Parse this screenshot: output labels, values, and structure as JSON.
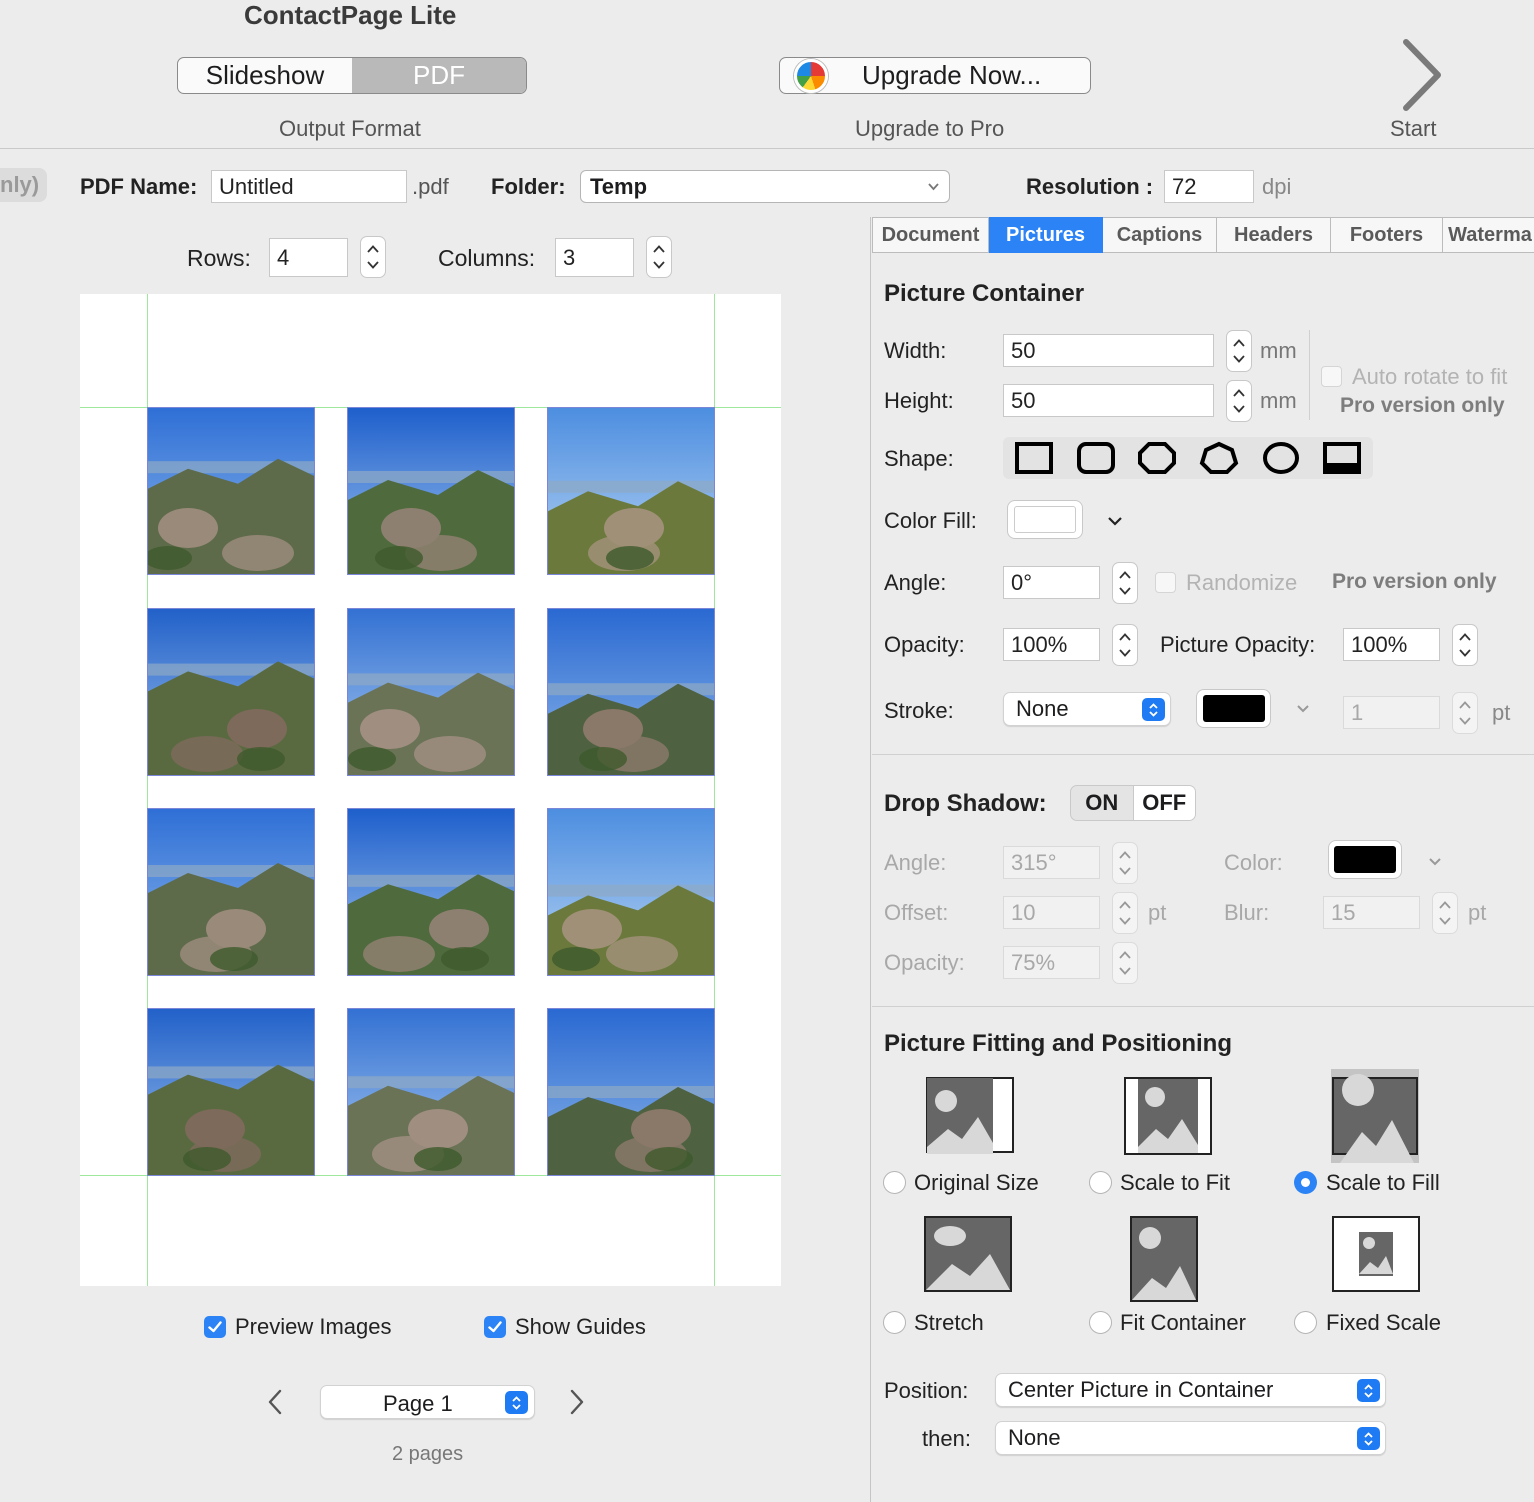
{
  "app": {
    "title": "ContactPage Lite"
  },
  "toolbar": {
    "output_format": {
      "options": [
        "Slideshow",
        "PDF"
      ],
      "selected": "PDF",
      "caption": "Output Format"
    },
    "upgrade": {
      "label": "Upgrade Now...",
      "caption": "Upgrade to Pro"
    },
    "start": {
      "caption": "Start"
    }
  },
  "settings_bar": {
    "left_badge": "nly)",
    "pdf_name_label": "PDF Name:",
    "pdf_name_value": "Untitled",
    "pdf_ext": ".pdf",
    "folder_label": "Folder:",
    "folder_value": "Temp",
    "resolution_label": "Resolution :",
    "resolution_value": "72",
    "resolution_unit": "dpi"
  },
  "grid": {
    "rows_label": "Rows:",
    "rows_value": "4",
    "columns_label": "Columns:",
    "columns_value": "3"
  },
  "preview": {
    "photo_count": 12,
    "preview_images_label": "Preview Images",
    "preview_images_checked": true,
    "show_guides_label": "Show Guides",
    "show_guides_checked": true,
    "page_value": "Page 1",
    "page_count": "2 pages"
  },
  "tabs": [
    {
      "label": "Document"
    },
    {
      "label": "Pictures",
      "active": true
    },
    {
      "label": "Captions"
    },
    {
      "label": "Headers"
    },
    {
      "label": "Footers"
    },
    {
      "label": "Waterma"
    }
  ],
  "picture_container": {
    "title": "Picture Container",
    "width_label": "Width:",
    "width_value": "50",
    "width_unit": "mm",
    "height_label": "Height:",
    "height_value": "50",
    "height_unit": "mm",
    "auto_rotate_label": "Auto rotate to fit",
    "pro_only_1": "Pro version only",
    "shape_label": "Shape:",
    "shapes": [
      "square",
      "rounded-square",
      "octagon",
      "heptagon",
      "circle",
      "framed-rect"
    ],
    "color_fill_label": "Color Fill:",
    "color_fill": "#ffffff",
    "angle_label": "Angle:",
    "angle_value": "0°",
    "randomize_label": "Randomize",
    "pro_only_2": "Pro version only",
    "opacity_label": "Opacity:",
    "opacity_value": "100%",
    "picture_opacity_label": "Picture Opacity:",
    "picture_opacity_value": "100%",
    "stroke_label": "Stroke:",
    "stroke_value": "None",
    "stroke_color": "#000000",
    "stroke_width": "1",
    "stroke_unit": "pt"
  },
  "drop_shadow": {
    "title": "Drop Shadow:",
    "on_label": "ON",
    "off_label": "OFF",
    "state": "OFF",
    "angle_label": "Angle:",
    "angle_value": "315°",
    "color_label": "Color:",
    "color": "#000000",
    "offset_label": "Offset:",
    "offset_value": "10",
    "offset_unit": "pt",
    "blur_label": "Blur:",
    "blur_value": "15",
    "blur_unit": "pt",
    "opacity_label": "Opacity:",
    "opacity_value": "75%"
  },
  "fitting": {
    "title": "Picture Fitting and Positioning",
    "options": [
      {
        "label": "Original Size",
        "icon": "original-size-icon"
      },
      {
        "label": "Scale to Fit",
        "icon": "scale-to-fit-icon"
      },
      {
        "label": "Scale to Fill",
        "icon": "scale-to-fill-icon",
        "selected": true
      },
      {
        "label": "Stretch",
        "icon": "stretch-icon"
      },
      {
        "label": "Fit Container",
        "icon": "fit-container-icon"
      },
      {
        "label": "Fixed Scale",
        "icon": "fixed-scale-icon"
      }
    ],
    "position_label": "Position:",
    "position_value": "Center Picture in Container",
    "then_label": "then:",
    "then_value": "None"
  },
  "colors": {
    "accent": "#2b83f6",
    "guide": "#9ee89e",
    "photo_border": "#7a86d8"
  }
}
